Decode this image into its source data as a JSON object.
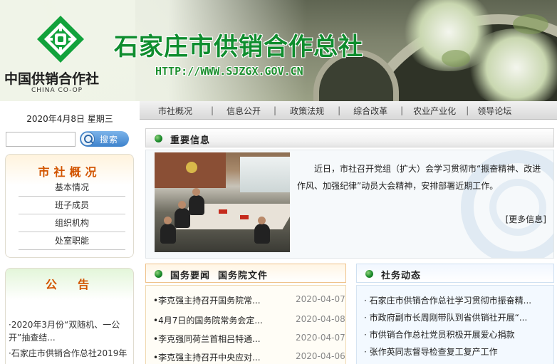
{
  "header": {
    "logo_cn": "中国供销合作社",
    "logo_en": "CHINA CO-OP",
    "site_title": "石家庄市供销合作总社",
    "site_url": "HTTP://WWW.SJZGX.GOV.CN"
  },
  "sidebar": {
    "date": "2020年4月8日 星期三",
    "search": {
      "placeholder": "",
      "button_label": "搜索"
    },
    "overview": {
      "title": "市社概况",
      "items": [
        "基本情况",
        "班子成员",
        "组织机构",
        "处室职能"
      ]
    },
    "notice": {
      "title": "公  告",
      "items": [
        "·2020年3月份“双随机、一公开”抽查结...",
        "·石家庄市供销合作总社2019年"
      ]
    }
  },
  "nav": {
    "items": [
      "市社概况",
      "信息公开",
      "政策法规",
      "综合改革",
      "农业产业化",
      "领导论坛"
    ],
    "separator": "|"
  },
  "important": {
    "title": "重要信息",
    "text": "近日，市社召开党组（扩大）会学习贯彻市“振奋精神、改进作风、加强纪律”动员大会精神，安排部署近期工作。",
    "more_label": "[更多信息]"
  },
  "gov_news": {
    "title": "国务要闻  国务院文件",
    "rows": [
      {
        "title": "•李克强主持召开国务院常...",
        "date": "2020-04-07"
      },
      {
        "title": "•4月7日的国务院常务会定...",
        "date": "2020-04-08"
      },
      {
        "title": "•李克强同荷兰首相吕特通...",
        "date": "2020-04-07"
      },
      {
        "title": "•李克强主持召开中央应对...",
        "date": "2020-04-06"
      }
    ]
  },
  "social_news": {
    "title": "社务动态",
    "rows": [
      {
        "title": "· 石家庄市供销合作总社学习贯彻市振奋精..."
      },
      {
        "title": "· 市政府副市长周刚带队到省供销社开展“..."
      },
      {
        "title": "· 市供销合作总社党员积极开展爱心捐款"
      },
      {
        "title": "· 张作英同志督导检查复工复产工作"
      }
    ]
  },
  "colors": {
    "brand_green": "#0f8d2e",
    "accent_orange": "#d25400",
    "search_blue": "#3d82cc"
  }
}
